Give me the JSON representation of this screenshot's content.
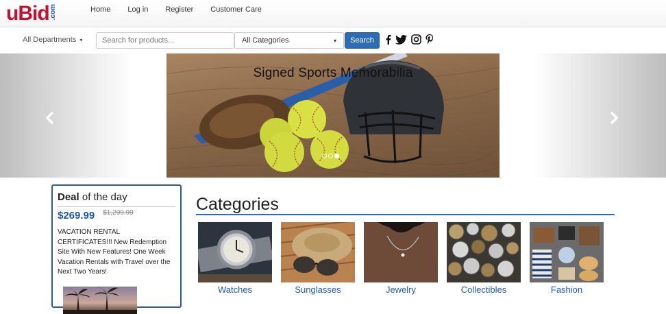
{
  "logo": {
    "u": "u",
    "bid": "Bid",
    "com": ".com"
  },
  "nav": {
    "links": [
      "Home",
      "Log in",
      "Register",
      "Customer Care"
    ]
  },
  "search": {
    "departments_label": "All Departments",
    "placeholder": "Search for products...",
    "category_selected": "All Categories",
    "button_label": "Search"
  },
  "social": [
    "facebook-icon",
    "twitter-icon",
    "instagram-icon",
    "pinterest-icon"
  ],
  "hero": {
    "title": "Signed Sports Memorabilia",
    "slide_count": 3,
    "active_slide": 3
  },
  "deal": {
    "title_bold": "Deal",
    "title_rest": " of the day",
    "price": "$269.99",
    "old_price": "$1,299.99",
    "description": "VACATION RENTAL CERTIFICATES!!! New Redemption Site With New Features! One Week Vacation Rentals with Travel over the Next Two Years!"
  },
  "categories": {
    "heading": "Categories",
    "items": [
      "Watches",
      "Sunglasses",
      "Jewelry",
      "Collectibles",
      "Fashion"
    ]
  },
  "colors": {
    "brand_red": "#c8102e",
    "brand_blue": "#1f57b4",
    "button_blue": "#2d6db5"
  }
}
